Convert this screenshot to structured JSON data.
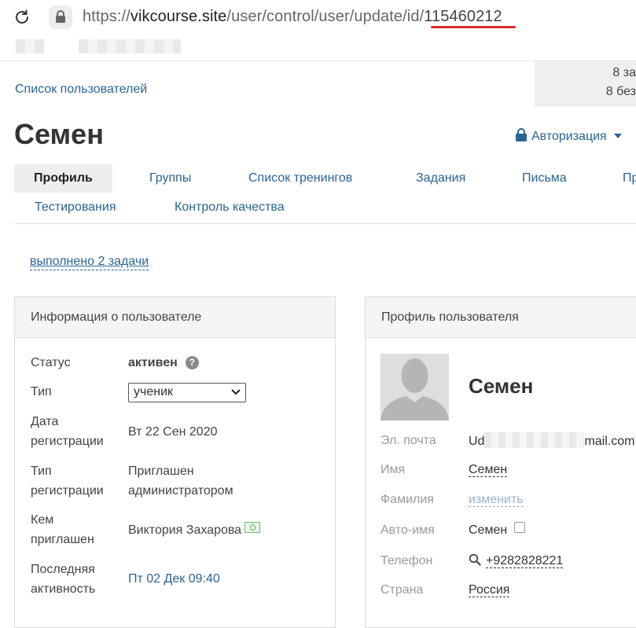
{
  "browser": {
    "url_scheme": "https://",
    "url_host": "vikcourse.site",
    "url_path": "/user/control/user/update/id/",
    "url_id": "115460212",
    "reload_icon": "reload-icon",
    "lock_icon": "lock-icon"
  },
  "header": {
    "users_list_link": "Список пользователей",
    "stats_line1": "8 за",
    "stats_line2": "8 без",
    "title": "Семен",
    "auth_label": "Авторизация",
    "auth_icon": "lock-icon"
  },
  "tabs": {
    "profile": "Профиль",
    "groups": "Группы",
    "trainings": "Список тренингов",
    "tasks": "Задания",
    "letters": "Письма",
    "more": "Пр",
    "testing": "Тестирования",
    "quality": "Контроль качества"
  },
  "tasks_done_link": "выполнено 2 задачи",
  "user_info": {
    "title": "Информация о пользователе",
    "status_label": "Статус",
    "status_value": "активен",
    "type_label": "Тип",
    "type_value": "ученик",
    "reg_date_label_1": "Дата",
    "reg_date_label_2": "регистрации",
    "reg_date_value": "Вт 22 Сен 2020",
    "reg_type_label_1": "Тип",
    "reg_type_label_2": "регистрации",
    "reg_type_value_1": "Приглашен",
    "reg_type_value_2": "администратором",
    "invited_by_label_1": "Кем",
    "invited_by_label_2": "приглашен",
    "invited_by_value": "Виктория Захарова",
    "last_activity_label_1": "Последняя",
    "last_activity_label_2": "активность",
    "last_activity_value": "Пт 02 Дек 09:40"
  },
  "user_profile": {
    "title": "Профиль пользователя",
    "name": "Семен",
    "email_label": "Эл. почта",
    "email_start": "Ud",
    "email_end": "mail.com",
    "first_name_label": "Имя",
    "first_name_value": "Семен",
    "last_name_label": "Фамилия",
    "last_name_value": "изменить",
    "auto_name_label": "Авто-имя",
    "auto_name_value": "Семен",
    "phone_label": "Телефон",
    "phone_value": "+9282828221",
    "country_label": "Страна",
    "country_value": "Россия"
  },
  "colors": {
    "link": "#2a6496",
    "url_underline": "#d62c2c",
    "panel_header": "#f5f5f5",
    "tab_active": "#eeeeee"
  }
}
